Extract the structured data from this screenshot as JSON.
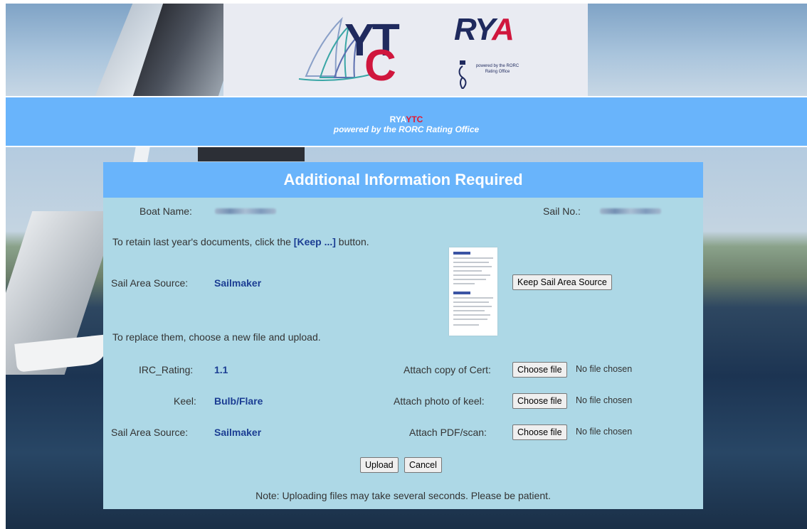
{
  "logos": {
    "ytc": {
      "y": "Y",
      "t": "T",
      "c": "C"
    },
    "rya": {
      "r": "R",
      "y": "Y",
      "a": "A"
    },
    "rorc_text": "powered by the RORC Rating Office"
  },
  "strip": {
    "rya": "RYA",
    "ytc": "YTC",
    "subtitle": "powered by the RORC Rating Office"
  },
  "panel": {
    "title": "Additional Information Required",
    "boat_name_label": "Boat Name:",
    "sail_no_label": "Sail No.:",
    "retain_prefix": "To retain last year's documents, click the ",
    "retain_keyword": "[Keep ...]",
    "retain_suffix": " button.",
    "keep_row": {
      "label": "Sail Area Source:",
      "value": "Sailmaker",
      "button": "Keep Sail Area Source"
    },
    "replace_text": "To replace them, choose a new file and upload.",
    "rows": [
      {
        "label": "IRC_Rating:",
        "value": "1.1",
        "attach_label": "Attach copy of Cert:"
      },
      {
        "label": "Keel:",
        "value": "Bulb/Flare",
        "attach_label": "Attach photo of keel:"
      },
      {
        "label": "Sail Area Source:",
        "value": "Sailmaker",
        "attach_label": "Attach PDF/scan:"
      }
    ],
    "choose_file": "Choose file",
    "no_file": "No file chosen",
    "upload_button": "Upload",
    "cancel_button": "Cancel",
    "note": "Note: Uploading files may take several seconds. Please be patient."
  },
  "colors": {
    "accent_blue": "#69b4fb",
    "panel_bg": "#add8e6",
    "value_blue": "#1b3d93",
    "brand_red": "#d0163d"
  }
}
